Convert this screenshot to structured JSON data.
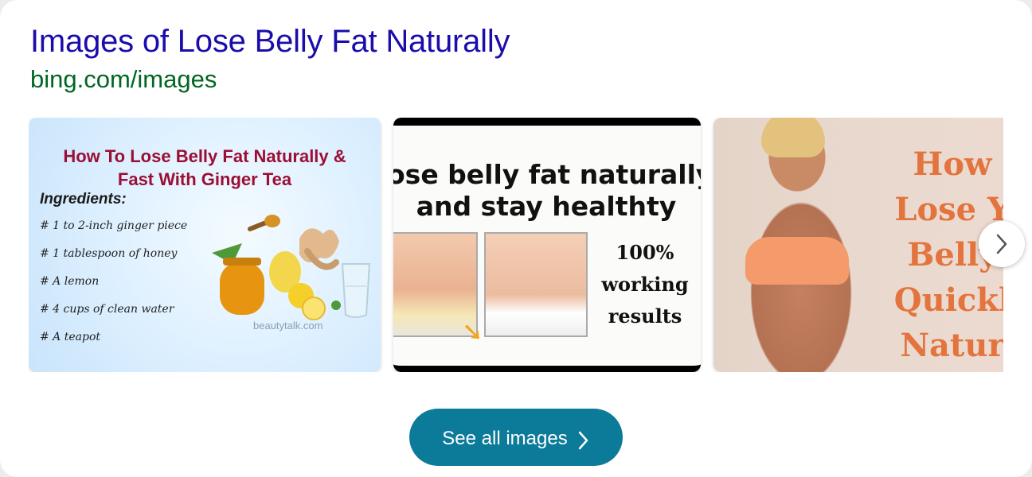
{
  "header": {
    "title": "Images of Lose Belly Fat Naturally",
    "source": "bing.com/images"
  },
  "images": [
    {
      "title_lines": [
        "How To Lose Belly Fat Naturally &",
        "Fast With Ginger Tea"
      ],
      "ingredients_label": "Ingredients:",
      "ingredients": [
        "# 1 to 2-inch ginger piece",
        "# 1 tablespoon of honey",
        "# A lemon",
        "# 4 cups of clean water",
        "# A teapot"
      ],
      "watermark": "beautytalk.com"
    },
    {
      "title_lines": [
        "ose belly fat naturally",
        "and stay healthty"
      ],
      "result_lines": [
        "100%",
        "working",
        "results"
      ]
    },
    {
      "title_lines": [
        "How",
        "Lose Y",
        "Belly",
        "Quickl",
        "Natur"
      ]
    }
  ],
  "next_icon": "chevron-right-icon",
  "see_all": {
    "label": "See all images",
    "icon": "chevron-right-icon"
  },
  "colors": {
    "title": "#1a0dab",
    "source": "#006621",
    "button": "#0c7a99"
  }
}
